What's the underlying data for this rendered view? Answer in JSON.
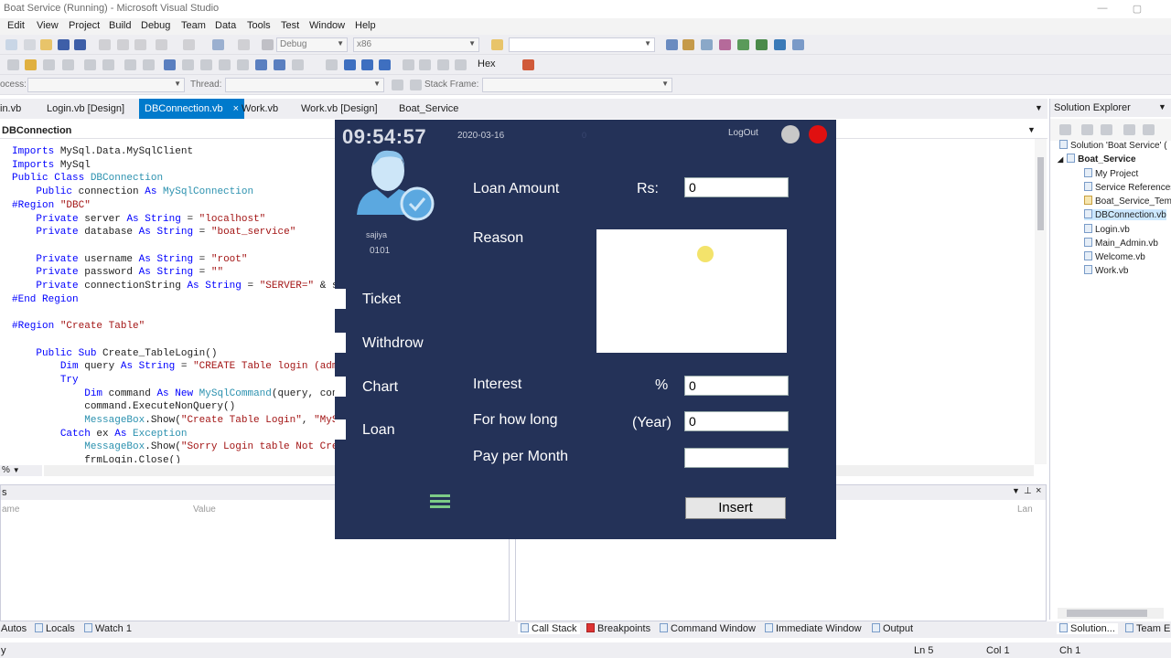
{
  "vs": {
    "window_title": "Boat Service (Running) - Microsoft Visual Studio",
    "menu": [
      "Edit",
      "View",
      "Project",
      "Build",
      "Debug",
      "Team",
      "Data",
      "Tools",
      "Test",
      "Window",
      "Help"
    ],
    "toolbar": {
      "config": "Debug",
      "platform": "x86",
      "hex_label": "Hex",
      "process_label": "ocess:",
      "thread_label": "Thread:",
      "stack_frame_label": "Stack Frame:"
    },
    "tabs": [
      "in.vb",
      "Login.vb [Design]",
      "DBConnection.vb",
      "Work.vb",
      "Work.vb [Design]",
      "Boat_Service"
    ],
    "active_tab_close": "×",
    "navbar_class": "DBConnection",
    "code_lines": [
      "Imports MySql.Data.MySqlClient",
      "Imports MySql",
      "Public Class DBConnection",
      "    Public connection As MySqlConnection",
      "#Region \"DBC\"",
      "    Private server As String = \"localhost\"",
      "    Private database As String = \"boat_service\"",
      "",
      "    Private username As String = \"root\"",
      "    Private password As String = \"\"",
      "    Private connectionString As String = \"SERVER=\" & serv",
      "#End Region",
      "",
      "#Region \"Create Table\"",
      "",
      "    Public Sub Create_TableLogin()",
      "        Dim query As String = \"CREATE Table login (admin_",
      "        Try",
      "            Dim command As New MySqlCommand(query, connec",
      "            command.ExecuteNonQuery()",
      "            MessageBox.Show(\"Create Table Login\", \"MySQL\"",
      "        Catch ex As Exception",
      "            MessageBox.Show(\"Sorry Login table Not Create",
      "            frmLogin.Close()"
    ],
    "zoom": "%",
    "lower_left": {
      "title": "s",
      "col_name": "ame",
      "col_value": "Value"
    },
    "lower_right": {
      "col_lang": "Lan"
    },
    "bottom_tabs_left": [
      "Autos",
      "Locals",
      "Watch 1"
    ],
    "bottom_tabs_right": [
      "Call Stack",
      "Breakpoints",
      "Command Window",
      "Immediate Window",
      "Output"
    ],
    "solution_explorer": {
      "title": "Solution Explorer",
      "items": [
        {
          "label": "Solution 'Boat Service' (",
          "level": 0
        },
        {
          "label": "Boat_Service",
          "level": 1,
          "bold": true
        },
        {
          "label": "My Project",
          "level": 2
        },
        {
          "label": "Service References",
          "level": 2
        },
        {
          "label": "Boat_Service_Tem",
          "level": 2
        },
        {
          "label": "DBConnection.vb",
          "level": 2,
          "selected": true
        },
        {
          "label": "Login.vb",
          "level": 2
        },
        {
          "label": "Main_Admin.vb",
          "level": 2
        },
        {
          "label": "Welcome.vb",
          "level": 2
        },
        {
          "label": "Work.vb",
          "level": 2
        }
      ],
      "bottom_tabs": [
        "Solution...",
        "Team E"
      ]
    },
    "status": {
      "left": "y",
      "ln": "Ln 5",
      "col": "Col 1",
      "ch": "Ch 1"
    }
  },
  "app": {
    "clock": "09:54:57",
    "date": "2020-03-16",
    "hidden_mark": "0",
    "logout": "LogOut",
    "user_name": "sajiya",
    "user_id": "0101",
    "nav": [
      "Ticket",
      "Withdrow",
      "Chart",
      "Loan"
    ],
    "form": {
      "loan_amount_label": "Loan Amount",
      "currency_label": "Rs:",
      "loan_amount_value": "0",
      "reason_label": "Reason",
      "reason_value": "",
      "interest_label": "Interest",
      "percent_label": "%",
      "interest_value": "0",
      "for_how_long_label": "For how long",
      "year_label": "(Year)",
      "for_how_long_value": "0",
      "pay_per_month_label": "Pay per Month",
      "pay_per_month_value": "",
      "insert_button": "Insert"
    }
  },
  "colors": {
    "accent": "#007ACC",
    "app_bg": "#243258",
    "close": "#E01010",
    "menu_icon": "#7CCB87"
  }
}
